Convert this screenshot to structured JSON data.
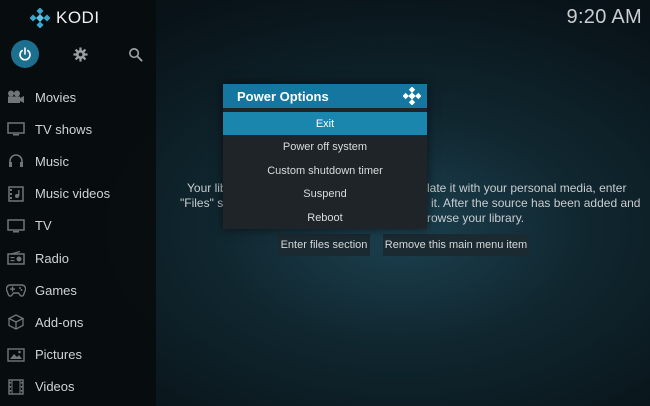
{
  "app": {
    "name": "KODI"
  },
  "clock": "9:20 AM",
  "top_icons": [
    "power-icon",
    "gear-icon",
    "search-icon"
  ],
  "sidebar": {
    "items": [
      {
        "label": "Movies",
        "icon": "movie-camera-icon"
      },
      {
        "label": "TV shows",
        "icon": "tv-icon"
      },
      {
        "label": "Music",
        "icon": "headphones-icon"
      },
      {
        "label": "Music videos",
        "icon": "music-video-icon"
      },
      {
        "label": "TV",
        "icon": "tv-icon"
      },
      {
        "label": "Radio",
        "icon": "radio-icon"
      },
      {
        "label": "Games",
        "icon": "gamepad-icon"
      },
      {
        "label": "Add-ons",
        "icon": "box-icon"
      },
      {
        "label": "Pictures",
        "icon": "picture-icon"
      },
      {
        "label": "Videos",
        "icon": "film-icon"
      }
    ]
  },
  "background": {
    "line1_left": "Your lib",
    "line1_right": "late it with your personal media, enter",
    "line2_left": "\"Files\" se",
    "line2_right": "it. After the source has been added and",
    "line3_right": "rowse your library.",
    "enter_files_button": "Enter files section",
    "remove_item_button": "Remove this main menu item"
  },
  "dialog": {
    "title": "Power Options",
    "options": [
      "Exit",
      "Power off system",
      "Custom shutdown timer",
      "Suspend",
      "Reboot"
    ],
    "selected_index": 0
  },
  "colors": {
    "accent": "#1577a0",
    "selected": "#1b86ad",
    "dialog_bg": "#1e2427"
  }
}
